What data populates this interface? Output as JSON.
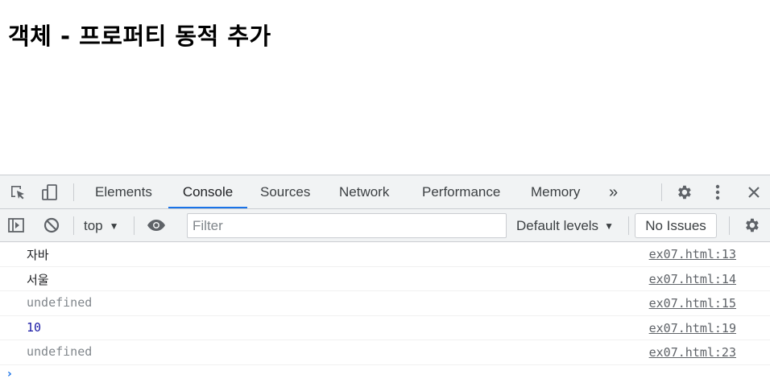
{
  "page": {
    "heading": "객체 - 프로퍼티 동적 추가"
  },
  "devtools": {
    "tabs": [
      {
        "label": "Elements",
        "active": false
      },
      {
        "label": "Console",
        "active": true
      },
      {
        "label": "Sources",
        "active": false
      },
      {
        "label": "Network",
        "active": false
      },
      {
        "label": "Performance",
        "active": false
      },
      {
        "label": "Memory",
        "active": false
      }
    ],
    "more_tabs": "»",
    "toolbar": {
      "context": "top",
      "filter_placeholder": "Filter",
      "levels": "Default levels",
      "issues": "No Issues"
    },
    "console": {
      "messages": [
        {
          "text": "자바",
          "source": "ex07.html:13",
          "kind": "string"
        },
        {
          "text": "서울",
          "source": "ex07.html:14",
          "kind": "string"
        },
        {
          "text": "undefined",
          "source": "ex07.html:15",
          "kind": "undefined"
        },
        {
          "text": "10",
          "source": "ex07.html:19",
          "kind": "number"
        },
        {
          "text": "undefined",
          "source": "ex07.html:23",
          "kind": "undefined"
        }
      ],
      "prompt": "›"
    },
    "colors": {
      "accent": "#1a73e8",
      "number": "#1a1aa6",
      "undefined": "#80868b",
      "toolbar_bg": "#f1f3f4"
    }
  }
}
